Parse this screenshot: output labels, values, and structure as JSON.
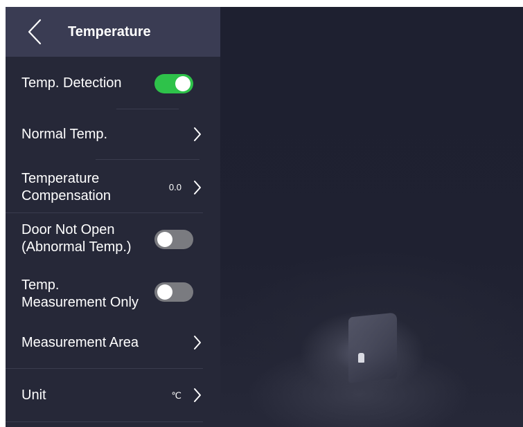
{
  "header": {
    "title": "Temperature"
  },
  "icons": {
    "back": "chevron-left-icon",
    "row_arrow": "chevron-right-icon"
  },
  "colors": {
    "toggle_on": "#2ec24a",
    "toggle_off": "#7a7b80",
    "panel_background": "#262838",
    "header_background": "#3a3c53"
  },
  "settings": {
    "temp_detection": {
      "label": "Temp. Detection",
      "enabled": true
    },
    "normal_temp": {
      "label": "Normal Temp."
    },
    "temp_compensation": {
      "label": "Temperature\nCompensation",
      "value": "0.0"
    },
    "door_not_open": {
      "label": "Door Not Open\n(Abnormal Temp.)",
      "enabled": false
    },
    "measurement_only": {
      "label": "Temp.\nMeasurement Only",
      "enabled": false
    },
    "measurement_area": {
      "label": "Measurement Area"
    },
    "unit": {
      "label": "Unit",
      "value": "℃"
    }
  }
}
